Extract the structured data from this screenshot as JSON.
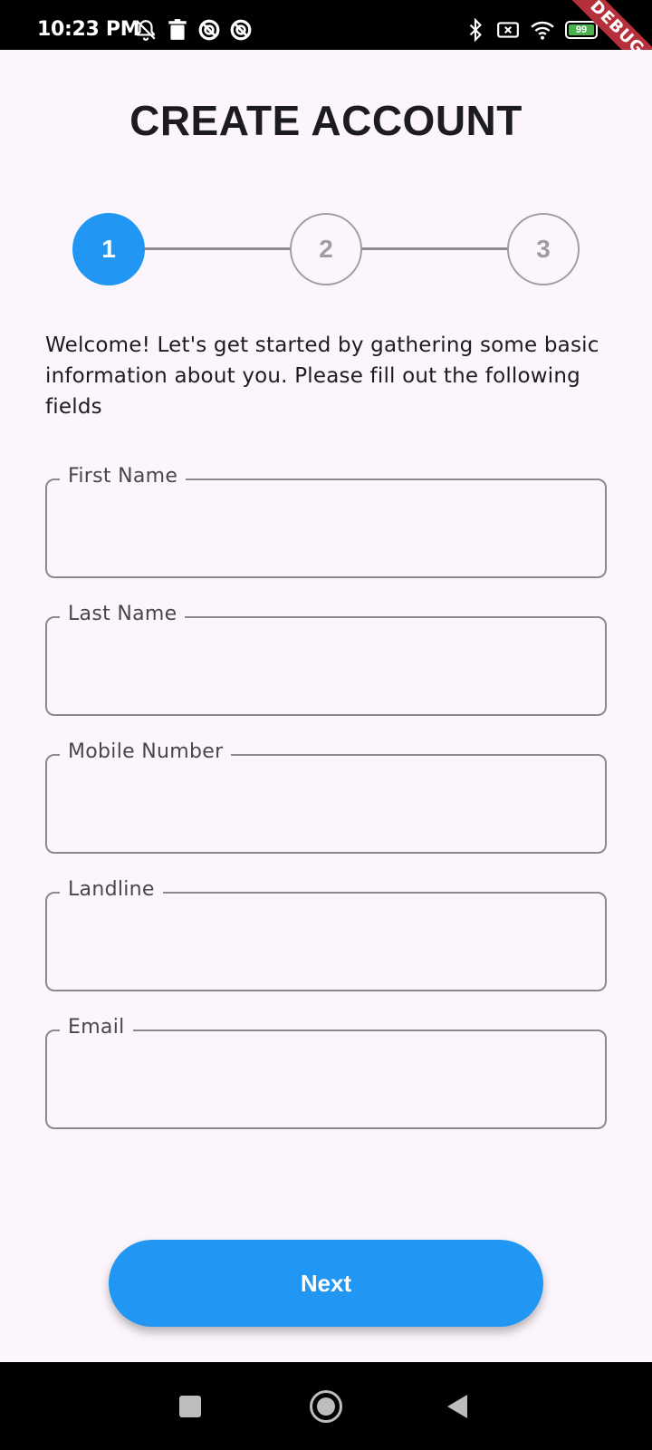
{
  "status_bar": {
    "time": "10:23 PM",
    "battery_level": "99",
    "debug_banner": "DEBUG",
    "left_icons": [
      "notifications-off-icon",
      "trash-icon",
      "blocked-app-icon",
      "blocked-app-icon"
    ],
    "right_icons": [
      "bluetooth-icon",
      "sim-off-icon",
      "wifi-icon",
      "battery-icon",
      "charging-icon"
    ]
  },
  "header": {
    "title": "CREATE ACCOUNT"
  },
  "stepper": {
    "steps": [
      {
        "label": "1",
        "active": true
      },
      {
        "label": "2",
        "active": false
      },
      {
        "label": "3",
        "active": false
      }
    ],
    "active_color": "#2196F3",
    "inactive_color": "#9E9E9E"
  },
  "intro_text": "Welcome! Let's get started by gathering some basic information about you. Please fill out the following fields",
  "form": {
    "fields": [
      {
        "label": "First Name",
        "value": ""
      },
      {
        "label": "Last Name",
        "value": ""
      },
      {
        "label": "Mobile Number",
        "value": ""
      },
      {
        "label": "Landline",
        "value": ""
      },
      {
        "label": "Email",
        "value": ""
      }
    ]
  },
  "actions": {
    "next_label": "Next"
  },
  "nav_bar": {
    "buttons": [
      "recents-square-icon",
      "home-circle-icon",
      "back-triangle-icon"
    ]
  },
  "colors": {
    "background": "#FCF6FC",
    "accent": "#2196F3",
    "outline": "#8A8A8A"
  }
}
